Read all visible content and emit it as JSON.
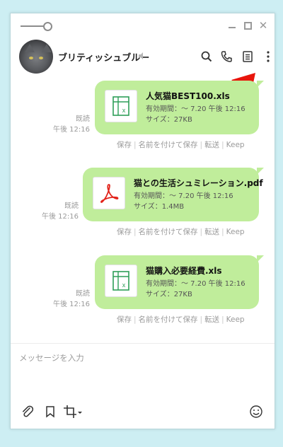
{
  "chat": {
    "name": "ブリティッシュブルー"
  },
  "input": {
    "placeholder": "メッセージを入力"
  },
  "messages": [
    {
      "file_name": "人気猫BEST100.xls",
      "expiry": "有効期間：～ 7.20 午後 12:16",
      "size": "サイズ：27KB",
      "file_type": "excel-icon",
      "read": "既読",
      "time": "午後 12:16"
    },
    {
      "file_name": "猫との生活シュミレーション.pdf",
      "expiry": "有効期間：～ 7.20 午後 12:16",
      "size": "サイズ：1.4MB",
      "file_type": "pdf-icon",
      "read": "既読",
      "time": "午後 12:16"
    },
    {
      "file_name": "猫購入必要経費.xls",
      "expiry": "有効期間：～ 7.20 午後 12:16",
      "size": "サイズ：27KB",
      "file_type": "excel-icon",
      "read": "既読",
      "time": "午後 12:16"
    }
  ],
  "file_actions": {
    "save": "保存",
    "save_as": "名前を付けて保存",
    "forward": "転送",
    "keep": "Keep"
  },
  "colors": {
    "bubble": "#c0ed9b",
    "background": "#cdeef3",
    "excel_green": "#2e9e58",
    "pdf_red": "#e2231a",
    "annotation_arrow": "#e8160c"
  }
}
